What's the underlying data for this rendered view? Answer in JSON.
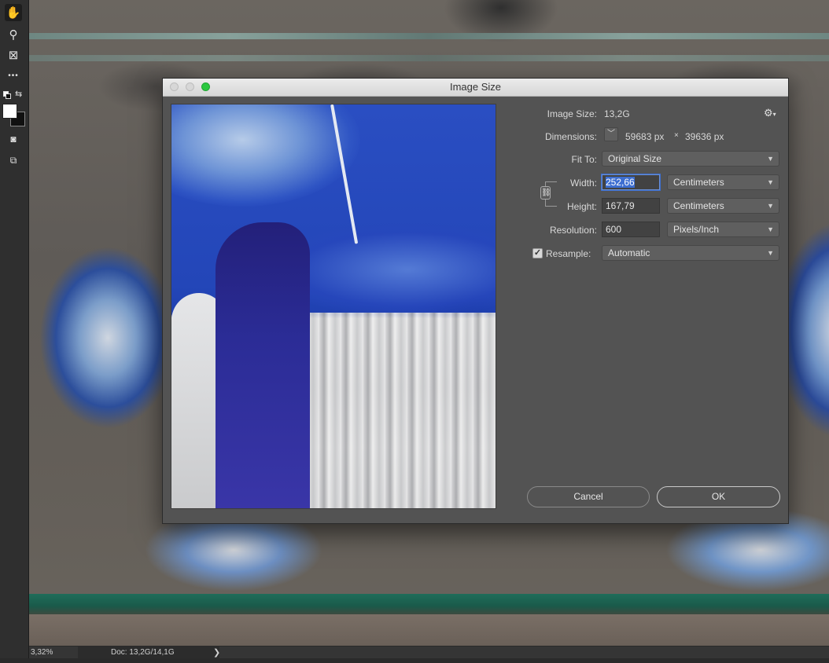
{
  "toolbar": {
    "tools": [
      {
        "name": "hand-tool-icon",
        "glyph": "✋",
        "active": true
      },
      {
        "name": "zoom-tool-icon",
        "glyph": "⚲"
      },
      {
        "name": "frame-tool-icon",
        "glyph": "⊠"
      },
      {
        "name": "more-tools-icon",
        "glyph": "•••"
      }
    ],
    "foreground_color": "#ffffff",
    "background_color": "#111111"
  },
  "statusbar": {
    "zoom": "3,32%",
    "doc": "Doc: 13,2G/14,1G",
    "arrow": "❯"
  },
  "dialog": {
    "title": "Image Size",
    "image_size_label": "Image Size:",
    "image_size_value": "13,2G",
    "dimensions_label": "Dimensions:",
    "dimensions_width": "59683 px",
    "dimensions_x": "×",
    "dimensions_height": "39636 px",
    "fit_to_label": "Fit To:",
    "fit_to_value": "Original Size",
    "width_label": "Width:",
    "width_value": "252,66",
    "width_unit": "Centimeters",
    "height_label": "Height:",
    "height_value": "167,79",
    "height_unit": "Centimeters",
    "resolution_label": "Resolution:",
    "resolution_value": "600",
    "resolution_unit": "Pixels/Inch",
    "resample_label": "Resample:",
    "resample_checked": true,
    "resample_value": "Automatic",
    "cancel_label": "Cancel",
    "ok_label": "OK"
  },
  "colors": {
    "accent_focus": "#3d6ed1",
    "dialog_bg": "#535353",
    "green_light": "#2bc840"
  }
}
